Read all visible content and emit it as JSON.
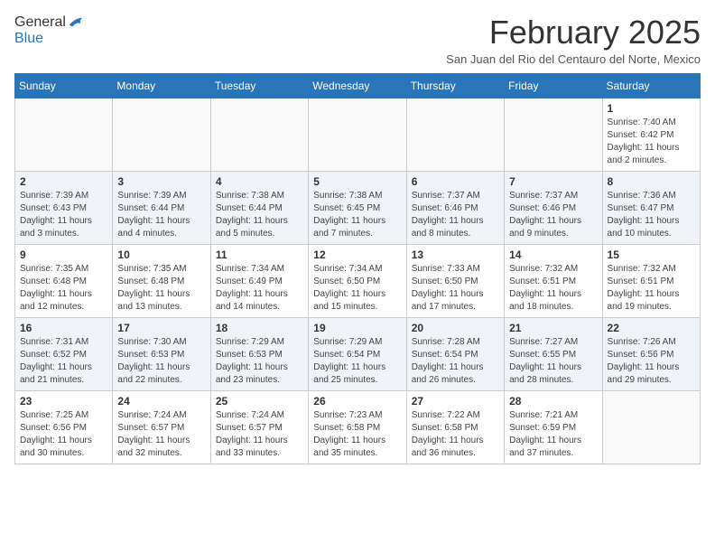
{
  "header": {
    "logo": {
      "general": "General",
      "blue": "Blue"
    },
    "title": "February 2025",
    "location": "San Juan del Rio del Centauro del Norte, Mexico"
  },
  "calendar": {
    "weekdays": [
      "Sunday",
      "Monday",
      "Tuesday",
      "Wednesday",
      "Thursday",
      "Friday",
      "Saturday"
    ],
    "weeks": [
      [
        {
          "day": "",
          "info": ""
        },
        {
          "day": "",
          "info": ""
        },
        {
          "day": "",
          "info": ""
        },
        {
          "day": "",
          "info": ""
        },
        {
          "day": "",
          "info": ""
        },
        {
          "day": "",
          "info": ""
        },
        {
          "day": "1",
          "info": "Sunrise: 7:40 AM\nSunset: 6:42 PM\nDaylight: 11 hours and 2 minutes."
        }
      ],
      [
        {
          "day": "2",
          "info": "Sunrise: 7:39 AM\nSunset: 6:43 PM\nDaylight: 11 hours and 3 minutes."
        },
        {
          "day": "3",
          "info": "Sunrise: 7:39 AM\nSunset: 6:44 PM\nDaylight: 11 hours and 4 minutes."
        },
        {
          "day": "4",
          "info": "Sunrise: 7:38 AM\nSunset: 6:44 PM\nDaylight: 11 hours and 5 minutes."
        },
        {
          "day": "5",
          "info": "Sunrise: 7:38 AM\nSunset: 6:45 PM\nDaylight: 11 hours and 7 minutes."
        },
        {
          "day": "6",
          "info": "Sunrise: 7:37 AM\nSunset: 6:46 PM\nDaylight: 11 hours and 8 minutes."
        },
        {
          "day": "7",
          "info": "Sunrise: 7:37 AM\nSunset: 6:46 PM\nDaylight: 11 hours and 9 minutes."
        },
        {
          "day": "8",
          "info": "Sunrise: 7:36 AM\nSunset: 6:47 PM\nDaylight: 11 hours and 10 minutes."
        }
      ],
      [
        {
          "day": "9",
          "info": "Sunrise: 7:35 AM\nSunset: 6:48 PM\nDaylight: 11 hours and 12 minutes."
        },
        {
          "day": "10",
          "info": "Sunrise: 7:35 AM\nSunset: 6:48 PM\nDaylight: 11 hours and 13 minutes."
        },
        {
          "day": "11",
          "info": "Sunrise: 7:34 AM\nSunset: 6:49 PM\nDaylight: 11 hours and 14 minutes."
        },
        {
          "day": "12",
          "info": "Sunrise: 7:34 AM\nSunset: 6:50 PM\nDaylight: 11 hours and 15 minutes."
        },
        {
          "day": "13",
          "info": "Sunrise: 7:33 AM\nSunset: 6:50 PM\nDaylight: 11 hours and 17 minutes."
        },
        {
          "day": "14",
          "info": "Sunrise: 7:32 AM\nSunset: 6:51 PM\nDaylight: 11 hours and 18 minutes."
        },
        {
          "day": "15",
          "info": "Sunrise: 7:32 AM\nSunset: 6:51 PM\nDaylight: 11 hours and 19 minutes."
        }
      ],
      [
        {
          "day": "16",
          "info": "Sunrise: 7:31 AM\nSunset: 6:52 PM\nDaylight: 11 hours and 21 minutes."
        },
        {
          "day": "17",
          "info": "Sunrise: 7:30 AM\nSunset: 6:53 PM\nDaylight: 11 hours and 22 minutes."
        },
        {
          "day": "18",
          "info": "Sunrise: 7:29 AM\nSunset: 6:53 PM\nDaylight: 11 hours and 23 minutes."
        },
        {
          "day": "19",
          "info": "Sunrise: 7:29 AM\nSunset: 6:54 PM\nDaylight: 11 hours and 25 minutes."
        },
        {
          "day": "20",
          "info": "Sunrise: 7:28 AM\nSunset: 6:54 PM\nDaylight: 11 hours and 26 minutes."
        },
        {
          "day": "21",
          "info": "Sunrise: 7:27 AM\nSunset: 6:55 PM\nDaylight: 11 hours and 28 minutes."
        },
        {
          "day": "22",
          "info": "Sunrise: 7:26 AM\nSunset: 6:56 PM\nDaylight: 11 hours and 29 minutes."
        }
      ],
      [
        {
          "day": "23",
          "info": "Sunrise: 7:25 AM\nSunset: 6:56 PM\nDaylight: 11 hours and 30 minutes."
        },
        {
          "day": "24",
          "info": "Sunrise: 7:24 AM\nSunset: 6:57 PM\nDaylight: 11 hours and 32 minutes."
        },
        {
          "day": "25",
          "info": "Sunrise: 7:24 AM\nSunset: 6:57 PM\nDaylight: 11 hours and 33 minutes."
        },
        {
          "day": "26",
          "info": "Sunrise: 7:23 AM\nSunset: 6:58 PM\nDaylight: 11 hours and 35 minutes."
        },
        {
          "day": "27",
          "info": "Sunrise: 7:22 AM\nSunset: 6:58 PM\nDaylight: 11 hours and 36 minutes."
        },
        {
          "day": "28",
          "info": "Sunrise: 7:21 AM\nSunset: 6:59 PM\nDaylight: 11 hours and 37 minutes."
        },
        {
          "day": "",
          "info": ""
        }
      ]
    ]
  }
}
